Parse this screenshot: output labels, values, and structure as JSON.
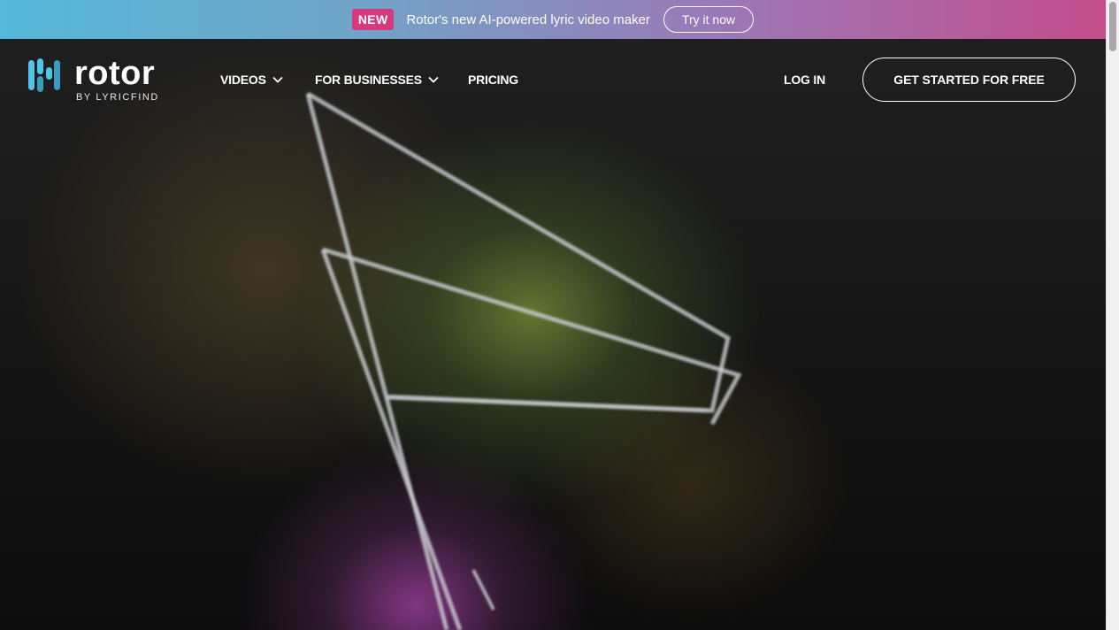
{
  "banner": {
    "badge": "NEW",
    "text": "Rotor's new AI-powered lyric video maker",
    "cta": "Try it now"
  },
  "logo": {
    "word": "rotor",
    "sub": "BY LYRICFIND",
    "icon": "rotor-logo-icon"
  },
  "nav": {
    "videos": "VIDEOS",
    "businesses": "FOR BUSINESSES",
    "pricing": "PRICING",
    "login": "LOG IN",
    "cta": "GET STARTED FOR FREE",
    "dropdown_icon": "chevron-down-icon"
  },
  "colors": {
    "badge": "#d63a7c",
    "banner_start": "#56b8da",
    "banner_end": "#c44d8c",
    "logo_blue": "#4fc3e8",
    "hero_bg": "#1b1b1b"
  }
}
